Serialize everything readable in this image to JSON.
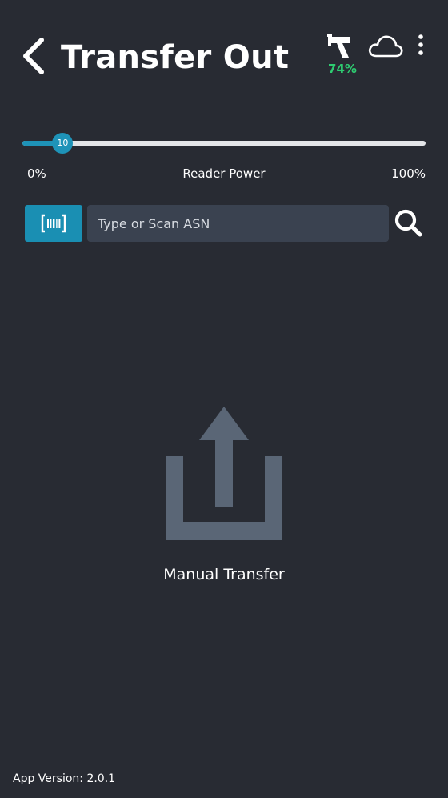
{
  "header": {
    "title": "Transfer Out",
    "back_icon": "chevron-left-icon",
    "scanner_icon": "scanner-gun-icon",
    "battery_level": "74%",
    "battery_color": "#2ecc71",
    "cloud_icon": "cloud-icon",
    "more_icon": "more-vertical-icon"
  },
  "slider": {
    "label": "Reader Power",
    "min_label": "0%",
    "max_label": "100%",
    "value": 10,
    "value_label": "10",
    "accent_color": "#1e93b8"
  },
  "search": {
    "barcode_icon": "barcode-icon",
    "placeholder": "Type or Scan ASN",
    "search_icon": "search-icon"
  },
  "manual_transfer": {
    "icon": "upload-icon",
    "label": "Manual Transfer"
  },
  "footer": {
    "app_version": "App Version: 2.0.1"
  },
  "colors": {
    "background": "#282b33",
    "input_background": "#3a4250",
    "icon_gray": "#5a6676",
    "button_blue": "#1a8fb3"
  }
}
